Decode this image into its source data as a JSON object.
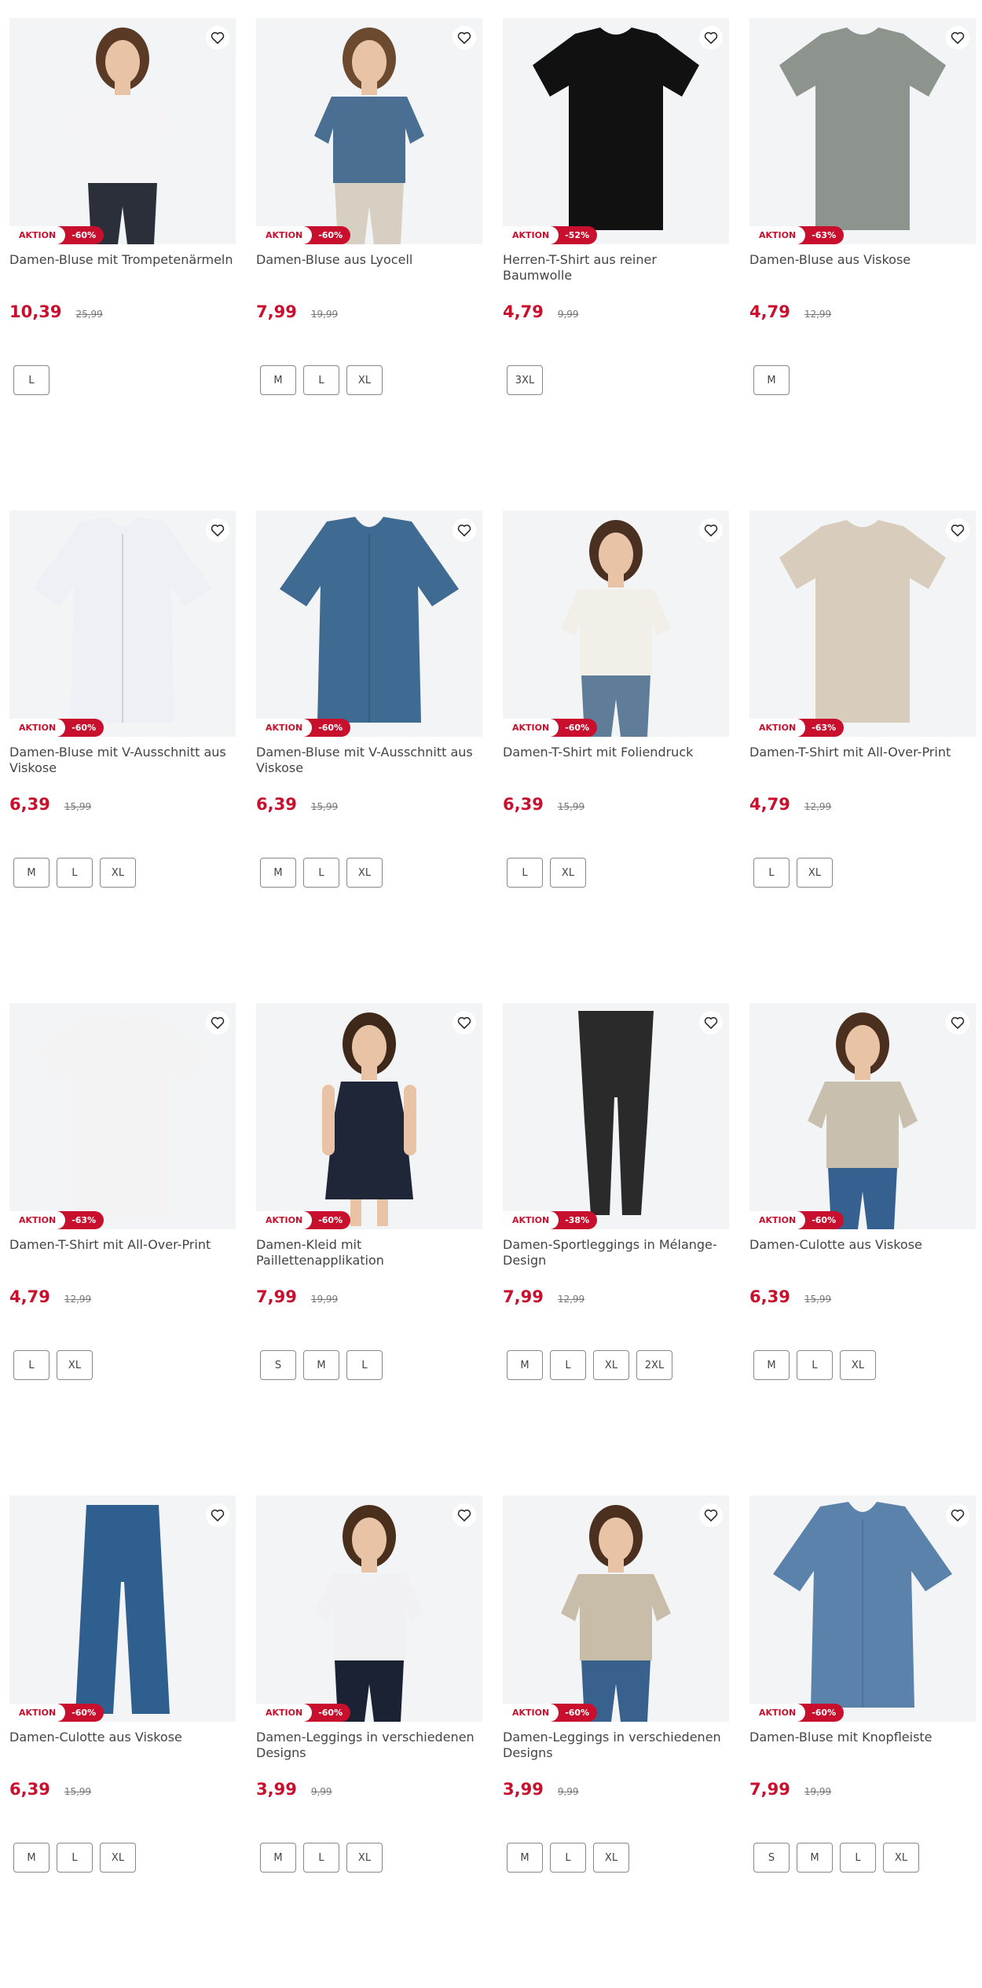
{
  "badge_label": "AKTION",
  "icons": {
    "favorite": "heart-outline-icon"
  },
  "colors": {
    "accent": "#c8102e",
    "image_bg": "#f2f4f5"
  },
  "products": [
    {
      "title": "Damen-Bluse mit Trompetenärmeln",
      "discount": "-60%",
      "price": "10,39",
      "old_price": "25,99",
      "sizes": [
        "L"
      ],
      "art": {
        "kind": "model-top",
        "top": "#f4f4f6",
        "bottom": "#2b2f3a",
        "hair": "#5a3a24"
      }
    },
    {
      "title": "Damen-Bluse aus Lyocell",
      "discount": "-60%",
      "price": "7,99",
      "old_price": "19,99",
      "sizes": [
        "M",
        "L",
        "XL"
      ],
      "art": {
        "kind": "model-top",
        "top": "#4a6f93",
        "bottom": "#d8cfc3",
        "hair": "#6b4a30"
      }
    },
    {
      "title": "Herren-T-Shirt aus reiner Baumwolle",
      "discount": "-52%",
      "price": "4,79",
      "old_price": "9,99",
      "sizes": [
        "3XL"
      ],
      "art": {
        "kind": "shirt",
        "top": "#111111"
      }
    },
    {
      "title": "Damen-Bluse aus Viskose",
      "discount": "-63%",
      "price": "4,79",
      "old_price": "12,99",
      "sizes": [
        "M"
      ],
      "art": {
        "kind": "shirt",
        "top": "#8d948e"
      }
    },
    {
      "title": "Damen-Bluse mit V-Ausschnitt aus Viskose",
      "discount": "-60%",
      "price": "6,39",
      "old_price": "15,99",
      "sizes": [
        "M",
        "L",
        "XL"
      ],
      "art": {
        "kind": "blouse",
        "top": "#eef0f5"
      }
    },
    {
      "title": "Damen-Bluse mit V-Ausschnitt aus Viskose",
      "discount": "-60%",
      "price": "6,39",
      "old_price": "15,99",
      "sizes": [
        "M",
        "L",
        "XL"
      ],
      "art": {
        "kind": "blouse",
        "top": "#3f6a92"
      }
    },
    {
      "title": "Damen-T-Shirt mit Foliendruck",
      "discount": "-60%",
      "price": "6,39",
      "old_price": "15,99",
      "sizes": [
        "L",
        "XL"
      ],
      "art": {
        "kind": "model-top",
        "top": "#f1efe8",
        "bottom": "#5f7c98",
        "hair": "#4a3020"
      }
    },
    {
      "title": "Damen-T-Shirt mit All-Over-Print",
      "discount": "-63%",
      "price": "4,79",
      "old_price": "12,99",
      "sizes": [
        "L",
        "XL"
      ],
      "art": {
        "kind": "shirt",
        "top": "#d8cdbd"
      }
    },
    {
      "title": "Damen-T-Shirt mit All-Over-Print",
      "discount": "-63%",
      "price": "4,79",
      "old_price": "12,99",
      "sizes": [
        "L",
        "XL"
      ],
      "art": {
        "kind": "shirt",
        "top": "#f3f3f3"
      }
    },
    {
      "title": "Damen-Kleid mit Paillettenapplikation",
      "discount": "-60%",
      "price": "7,99",
      "old_price": "19,99",
      "sizes": [
        "S",
        "M",
        "L"
      ],
      "art": {
        "kind": "model-dress",
        "top": "#1e2638",
        "bottom": "#1e2638",
        "hair": "#3d281a"
      }
    },
    {
      "title": "Damen-Sportleggings in Mélange-Design",
      "discount": "-38%",
      "price": "7,99",
      "old_price": "12,99",
      "sizes": [
        "M",
        "L",
        "XL",
        "2XL"
      ],
      "art": {
        "kind": "leggings",
        "top": "#2a2a2a"
      }
    },
    {
      "title": "Damen-Culotte aus Viskose",
      "discount": "-60%",
      "price": "6,39",
      "old_price": "15,99",
      "sizes": [
        "M",
        "L",
        "XL"
      ],
      "art": {
        "kind": "model-top",
        "top": "#c9bfae",
        "bottom": "#35608f",
        "hair": "#4b2f1f"
      }
    },
    {
      "title": "Damen-Culotte aus Viskose",
      "discount": "-60%",
      "price": "6,39",
      "old_price": "15,99",
      "sizes": [
        "M",
        "L",
        "XL"
      ],
      "art": {
        "kind": "pants",
        "top": "#2f5f8e"
      }
    },
    {
      "title": "Damen-Leggings in verschiedenen Designs",
      "discount": "-60%",
      "price": "3,99",
      "old_price": "9,99",
      "sizes": [
        "M",
        "L",
        "XL"
      ],
      "art": {
        "kind": "model-top",
        "top": "#f1f1f3",
        "bottom": "#1a2234",
        "hair": "#4a2f1d"
      }
    },
    {
      "title": "Damen-Leggings in verschiedenen Designs",
      "discount": "-60%",
      "price": "3,99",
      "old_price": "9,99",
      "sizes": [
        "M",
        "L",
        "XL"
      ],
      "art": {
        "kind": "model-top",
        "top": "#c8bda9",
        "bottom": "#38618d",
        "hair": "#4b2f1f"
      }
    },
    {
      "title": "Damen-Bluse mit Knopfleiste",
      "discount": "-60%",
      "price": "7,99",
      "old_price": "19,99",
      "sizes": [
        "S",
        "M",
        "L",
        "XL"
      ],
      "art": {
        "kind": "blouse",
        "top": "#5b82ab"
      }
    }
  ]
}
